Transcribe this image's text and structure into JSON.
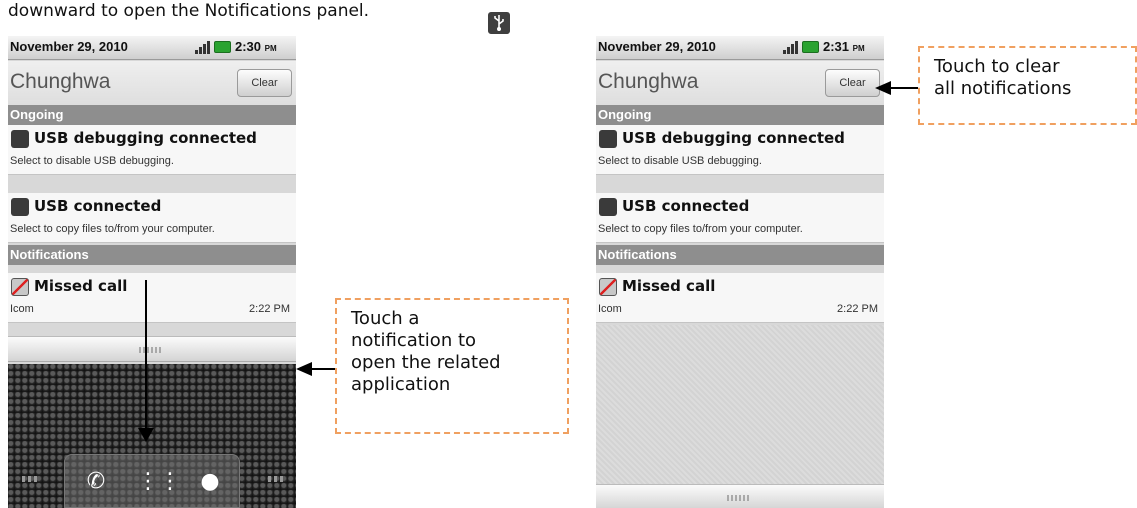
{
  "caption": "downward to open the Notifications panel.",
  "left_screen": {
    "status": {
      "date": "November 29, 2010",
      "time": "2:30",
      "ampm": "PM"
    },
    "carrier": "Chunghwa",
    "clear_label": "Clear",
    "ongoing_header": "Ongoing",
    "ongoing": [
      {
        "title": "USB debugging connected",
        "subtitle": "Select to disable USB debugging."
      },
      {
        "title": "USB connected",
        "subtitle": "Select to copy files to/from your computer."
      }
    ],
    "notifications_header": "Notifications",
    "notifications": [
      {
        "title": "Missed call",
        "subtitle": "Icom",
        "time": "2:22 PM"
      }
    ]
  },
  "right_screen": {
    "status": {
      "date": "November 29, 2010",
      "time": "2:31",
      "ampm": "PM"
    },
    "carrier": "Chunghwa",
    "clear_label": "Clear",
    "ongoing_header": "Ongoing",
    "ongoing": [
      {
        "title": "USB debugging connected",
        "subtitle": "Select to disable USB debugging."
      },
      {
        "title": "USB connected",
        "subtitle": "Select to copy files to/from your computer."
      }
    ],
    "notifications_header": "Notifications",
    "notifications": [
      {
        "title": "Missed call",
        "subtitle": "Icom",
        "time": "2:22 PM"
      }
    ]
  },
  "callouts": {
    "open_notification": [
      "Touch a",
      "notification to",
      "open the related",
      "application"
    ],
    "clear_all": [
      "Touch to clear",
      "all notifications"
    ]
  },
  "icons": {
    "usb": "usb-icon",
    "missed_call": "missed-call-icon",
    "phone": "phone-icon",
    "apps": "apps-grid-icon",
    "browser": "browser-globe-icon"
  },
  "colors": {
    "callout_border": "#f0a060",
    "section_header": "#8e8e8e",
    "battery": "#2aa330"
  }
}
